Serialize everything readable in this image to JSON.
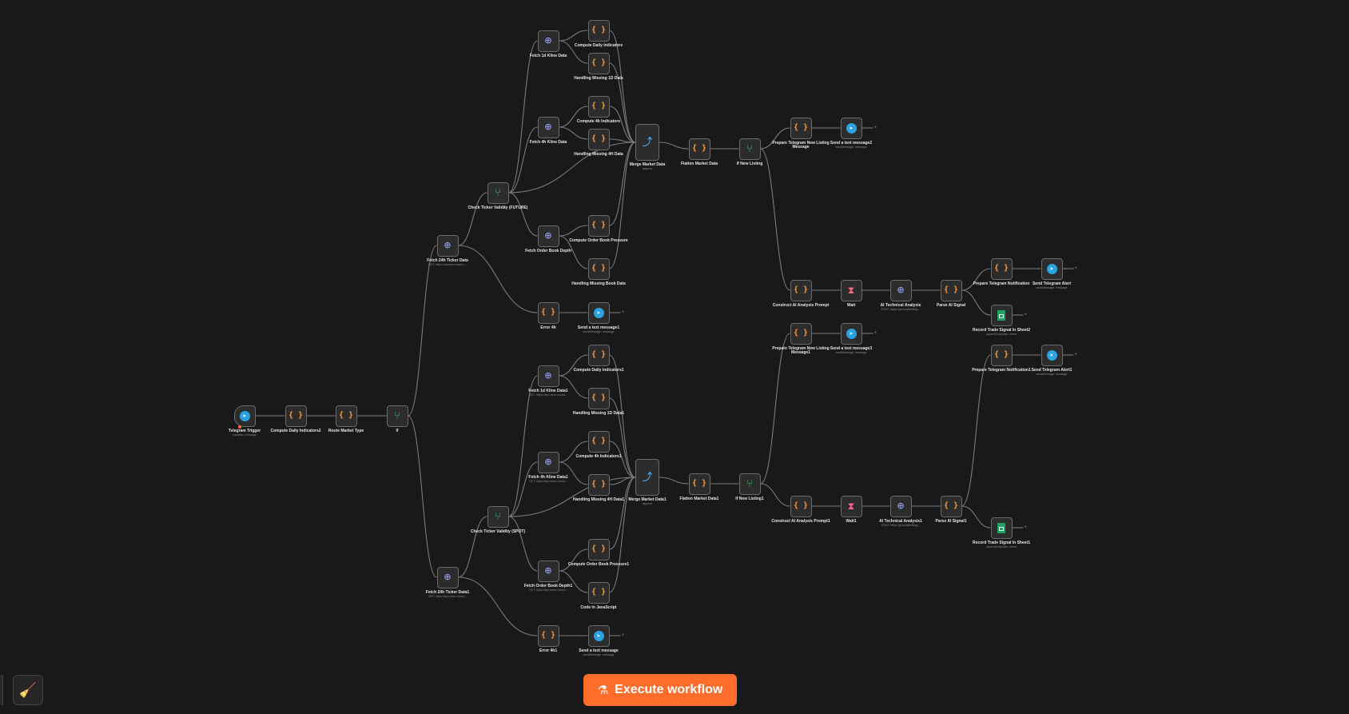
{
  "toolbar": {
    "execute_label": "Execute workflow",
    "flask_icon": "flask-icon",
    "clean_icon": "broom-icon"
  },
  "colors": {
    "canvas": "#191919",
    "accent": "#ff6d2d",
    "code_icon": "#ff9b3d",
    "if_icon": "#35c46a",
    "telegram": "#2aa3e0",
    "sheets": "#1ea362"
  },
  "nodes": [
    {
      "id": "telegram-trigger",
      "title": "Telegram Trigger",
      "sub": "Updates: message",
      "icon": "telegram-icon"
    },
    {
      "id": "compute-daily-indicators2",
      "title": "Compute Daily Indicators2",
      "sub": "",
      "icon": "code-icon"
    },
    {
      "id": "route-market-type",
      "title": "Route Market Type",
      "sub": "",
      "icon": "code-icon"
    },
    {
      "id": "if",
      "title": "If",
      "sub": "",
      "icon": "if-icon"
    },
    {
      "id": "fetch-24h-ticker-data",
      "title": "Fetch 24h Ticker Data",
      "sub": "GET: https://contract.mexc.c...",
      "icon": "http-icon"
    },
    {
      "id": "check-ticker-validity-futures",
      "title": "Check Ticker Validity (FUTURE)",
      "sub": "",
      "icon": "if-icon"
    },
    {
      "id": "fetch-1d-kline-data",
      "title": "Fetch 1d Kline Data",
      "sub": "",
      "icon": "http-icon"
    },
    {
      "id": "compute-daily-indicators",
      "title": "Compute Daily Indicators",
      "sub": "",
      "icon": "code-icon"
    },
    {
      "id": "handling-missing-1d-data",
      "title": "Handling Missing 1D Data",
      "sub": "",
      "icon": "code-icon"
    },
    {
      "id": "fetch-4h-kline-data",
      "title": "Fetch 4h Kline Data",
      "sub": "",
      "icon": "http-icon"
    },
    {
      "id": "compute-4h-indicators",
      "title": "Compute 4h Indicators",
      "sub": "",
      "icon": "code-icon"
    },
    {
      "id": "handling-missing-4h-data",
      "title": "Handling Missing 4H Data",
      "sub": "",
      "icon": "code-icon"
    },
    {
      "id": "merge-market-data",
      "title": "Merge Market Data",
      "sub": "append",
      "icon": "merge-icon"
    },
    {
      "id": "flatten-market-data",
      "title": "Flatten Market Data",
      "sub": "",
      "icon": "code-icon"
    },
    {
      "id": "if-new-listing",
      "title": "If New Listing",
      "sub": "",
      "icon": "if-icon"
    },
    {
      "id": "prepare-telegram-new-listing-message",
      "title": "Prepare Telegram New Listing Message",
      "sub": "",
      "icon": "code-icon"
    },
    {
      "id": "send-a-text-message2",
      "title": "Send a text message2",
      "sub": "sendMessage: message",
      "icon": "telegram-icon"
    },
    {
      "id": "fetch-order-book-depth",
      "title": "Fetch Order Book Depth",
      "sub": "",
      "icon": "http-icon"
    },
    {
      "id": "compute-order-book-pressure",
      "title": "Compute Order Book Pressure",
      "sub": "",
      "icon": "code-icon"
    },
    {
      "id": "handling-missing-book-data",
      "title": "Handling Missing Book Data",
      "sub": "",
      "icon": "code-icon"
    },
    {
      "id": "error-4h",
      "title": "Error 4h",
      "sub": "",
      "icon": "code-icon"
    },
    {
      "id": "send-a-text-message1",
      "title": "Send a text message1",
      "sub": "sendMessage: message",
      "icon": "telegram-icon"
    },
    {
      "id": "construct-ai-analysis-prompt",
      "title": "Construct AI Analysis Prompt",
      "sub": "",
      "icon": "code-icon"
    },
    {
      "id": "wait",
      "title": "Wait",
      "sub": "",
      "icon": "hourglass-icon"
    },
    {
      "id": "ai-technical-analysis",
      "title": "AI Technical Analysis",
      "sub": "POST: https://generativelang...",
      "icon": "http-icon"
    },
    {
      "id": "parse-ai-signal",
      "title": "Parse AI Signal",
      "sub": "",
      "icon": "code-icon"
    },
    {
      "id": "prepare-telegram-notification",
      "title": "Prepare Telegram Notification",
      "sub": "",
      "icon": "code-icon"
    },
    {
      "id": "send-telegram-alert",
      "title": "Send Telegram Alert",
      "sub": "sendMessage: message",
      "icon": "telegram-icon"
    },
    {
      "id": "record-trade-signal-in-sheet2",
      "title": "Record Trade Signal In Sheet2",
      "sub": "appendOrUpdate: sheet",
      "icon": "sheets-icon"
    },
    {
      "id": "prepare-telegram-new-listing-message1",
      "title": "Prepare Telegram New Listing Message1",
      "sub": "",
      "icon": "code-icon"
    },
    {
      "id": "send-a-text-message3",
      "title": "Send a text message3",
      "sub": "sendMessage: message",
      "icon": "telegram-icon"
    },
    {
      "id": "prepare-telegram-notification1",
      "title": "Prepare Telegram Notification1",
      "sub": "",
      "icon": "code-icon"
    },
    {
      "id": "send-telegram-alert1",
      "title": "Send Telegram Alert1",
      "sub": "sendMessage: message",
      "icon": "telegram-icon"
    },
    {
      "id": "fetch-1d-kline-data1",
      "title": "Fetch 1d Kline Data1",
      "sub": "GET: https://api.mexc.com/a...",
      "icon": "http-icon"
    },
    {
      "id": "compute-daily-indicators1",
      "title": "Compute Daily Indicators1",
      "sub": "",
      "icon": "code-icon"
    },
    {
      "id": "handling-missing-1d-data1",
      "title": "Handling Missing 1D Data1",
      "sub": "",
      "icon": "code-icon"
    },
    {
      "id": "fetch-4h-kline-data1",
      "title": "Fetch 4h Kline Data1",
      "sub": "GET: https://api.mexc.com/a...",
      "icon": "http-icon"
    },
    {
      "id": "compute-4h-indicators1",
      "title": "Compute 4h Indicators1",
      "sub": "",
      "icon": "code-icon"
    },
    {
      "id": "handling-missing-4h-data1",
      "title": "Handling Missing 4H Data1",
      "sub": "",
      "icon": "code-icon"
    },
    {
      "id": "merge-market-data1",
      "title": "Merge Market Data1",
      "sub": "append",
      "icon": "merge-icon"
    },
    {
      "id": "flatten-market-data1",
      "title": "Flatten Market Data1",
      "sub": "",
      "icon": "code-icon"
    },
    {
      "id": "if-new-listing1",
      "title": "If New Listing1",
      "sub": "",
      "icon": "if-icon"
    },
    {
      "id": "check-ticker-validity-spot",
      "title": "Check Ticker Validity (SPOT)",
      "sub": "",
      "icon": "if-icon"
    },
    {
      "id": "fetch-order-book-depth1",
      "title": "Fetch Order Book Depth1",
      "sub": "GET: https://api.mexc.com/a...",
      "icon": "http-icon"
    },
    {
      "id": "compute-order-book-pressure1",
      "title": "Compute Order Book Pressure1",
      "sub": "",
      "icon": "code-icon"
    },
    {
      "id": "code-in-javascript",
      "title": "Code in JavaScript",
      "sub": "",
      "icon": "code-icon"
    },
    {
      "id": "fetch-24h-ticker-data1",
      "title": "Fetch 24h Ticker Data1",
      "sub": "GET: https://api.mexc.com/a...",
      "icon": "http-icon"
    },
    {
      "id": "error-4h1",
      "title": "Error 4h1",
      "sub": "",
      "icon": "code-icon"
    },
    {
      "id": "send-a-text-message",
      "title": "Send a text message",
      "sub": "sendMessage: message",
      "icon": "telegram-icon"
    },
    {
      "id": "construct-ai-analysis-prompt1",
      "title": "Construct AI Analysis Prompt1",
      "sub": "",
      "icon": "code-icon"
    },
    {
      "id": "wait1",
      "title": "Wait1",
      "sub": "",
      "icon": "hourglass-icon"
    },
    {
      "id": "ai-technical-analysis1",
      "title": "AI Technical Analysis1",
      "sub": "POST: https://generativelang...",
      "icon": "http-icon"
    },
    {
      "id": "parse-ai-signal1",
      "title": "Parse AI Signal1",
      "sub": "",
      "icon": "code-icon"
    },
    {
      "id": "record-trade-signal-in-sheet1",
      "title": "Record Trade Signal In Sheet1",
      "sub": "appendOrUpdate: sheet",
      "icon": "sheets-icon"
    }
  ],
  "connections": [
    [
      "telegram-trigger",
      "compute-daily-indicators2"
    ],
    [
      "compute-daily-indicators2",
      "route-market-type"
    ],
    [
      "route-market-type",
      "if"
    ],
    [
      "if",
      "fetch-24h-ticker-data"
    ],
    [
      "if",
      "fetch-24h-ticker-data1"
    ],
    [
      "fetch-24h-ticker-data",
      "check-ticker-validity-futures"
    ],
    [
      "fetch-24h-ticker-data",
      "error-4h"
    ],
    [
      "check-ticker-validity-futures",
      "fetch-1d-kline-data"
    ],
    [
      "check-ticker-validity-futures",
      "fetch-4h-kline-data"
    ],
    [
      "check-ticker-validity-futures",
      "fetch-order-book-depth"
    ],
    [
      "check-ticker-validity-futures",
      "merge-market-data"
    ],
    [
      "fetch-1d-kline-data",
      "compute-daily-indicators"
    ],
    [
      "fetch-1d-kline-data",
      "handling-missing-1d-data"
    ],
    [
      "fetch-4h-kline-data",
      "compute-4h-indicators"
    ],
    [
      "fetch-4h-kline-data",
      "handling-missing-4h-data"
    ],
    [
      "fetch-order-book-depth",
      "compute-order-book-pressure"
    ],
    [
      "fetch-order-book-depth",
      "handling-missing-book-data"
    ],
    [
      "compute-daily-indicators",
      "merge-market-data"
    ],
    [
      "handling-missing-1d-data",
      "merge-market-data"
    ],
    [
      "compute-4h-indicators",
      "merge-market-data"
    ],
    [
      "handling-missing-4h-data",
      "merge-market-data"
    ],
    [
      "compute-order-book-pressure",
      "merge-market-data"
    ],
    [
      "handling-missing-book-data",
      "merge-market-data"
    ],
    [
      "merge-market-data",
      "flatten-market-data"
    ],
    [
      "flatten-market-data",
      "if-new-listing"
    ],
    [
      "if-new-listing",
      "prepare-telegram-new-listing-message"
    ],
    [
      "if-new-listing",
      "construct-ai-analysis-prompt"
    ],
    [
      "prepare-telegram-new-listing-message",
      "send-a-text-message2"
    ],
    [
      "error-4h",
      "send-a-text-message1"
    ],
    [
      "construct-ai-analysis-prompt",
      "wait"
    ],
    [
      "wait",
      "ai-technical-analysis"
    ],
    [
      "ai-technical-analysis",
      "parse-ai-signal"
    ],
    [
      "parse-ai-signal",
      "prepare-telegram-notification"
    ],
    [
      "parse-ai-signal",
      "record-trade-signal-in-sheet2"
    ],
    [
      "prepare-telegram-notification",
      "send-telegram-alert"
    ],
    [
      "fetch-24h-ticker-data1",
      "check-ticker-validity-spot"
    ],
    [
      "fetch-24h-ticker-data1",
      "error-4h1"
    ],
    [
      "check-ticker-validity-spot",
      "fetch-1d-kline-data1"
    ],
    [
      "check-ticker-validity-spot",
      "fetch-4h-kline-data1"
    ],
    [
      "check-ticker-validity-spot",
      "fetch-order-book-depth1"
    ],
    [
      "check-ticker-validity-spot",
      "merge-market-data1"
    ],
    [
      "fetch-1d-kline-data1",
      "compute-daily-indicators1"
    ],
    [
      "fetch-1d-kline-data1",
      "handling-missing-1d-data1"
    ],
    [
      "fetch-4h-kline-data1",
      "compute-4h-indicators1"
    ],
    [
      "fetch-4h-kline-data1",
      "handling-missing-4h-data1"
    ],
    [
      "fetch-order-book-depth1",
      "compute-order-book-pressure1"
    ],
    [
      "fetch-order-book-depth1",
      "code-in-javascript"
    ],
    [
      "compute-daily-indicators1",
      "merge-market-data1"
    ],
    [
      "handling-missing-1d-data1",
      "merge-market-data1"
    ],
    [
      "compute-4h-indicators1",
      "merge-market-data1"
    ],
    [
      "handling-missing-4h-data1",
      "merge-market-data1"
    ],
    [
      "compute-order-book-pressure1",
      "merge-market-data1"
    ],
    [
      "code-in-javascript",
      "merge-market-data1"
    ],
    [
      "merge-market-data1",
      "flatten-market-data1"
    ],
    [
      "flatten-market-data1",
      "if-new-listing1"
    ],
    [
      "if-new-listing1",
      "prepare-telegram-new-listing-message1"
    ],
    [
      "if-new-listing1",
      "construct-ai-analysis-prompt1"
    ],
    [
      "prepare-telegram-new-listing-message1",
      "send-a-text-message3"
    ],
    [
      "error-4h1",
      "send-a-text-message"
    ],
    [
      "construct-ai-analysis-prompt1",
      "wait1"
    ],
    [
      "wait1",
      "ai-technical-analysis1"
    ],
    [
      "ai-technical-analysis1",
      "parse-ai-signal1"
    ],
    [
      "parse-ai-signal1",
      "prepare-telegram-notification1"
    ],
    [
      "parse-ai-signal1",
      "record-trade-signal-in-sheet1"
    ],
    [
      "prepare-telegram-notification1",
      "send-telegram-alert1"
    ]
  ],
  "terminal_nodes": [
    "send-a-text-message2",
    "send-a-text-message1",
    "send-telegram-alert",
    "record-trade-signal-in-sheet2",
    "send-a-text-message3",
    "send-telegram-alert1",
    "record-trade-signal-in-sheet1",
    "send-a-text-message"
  ]
}
